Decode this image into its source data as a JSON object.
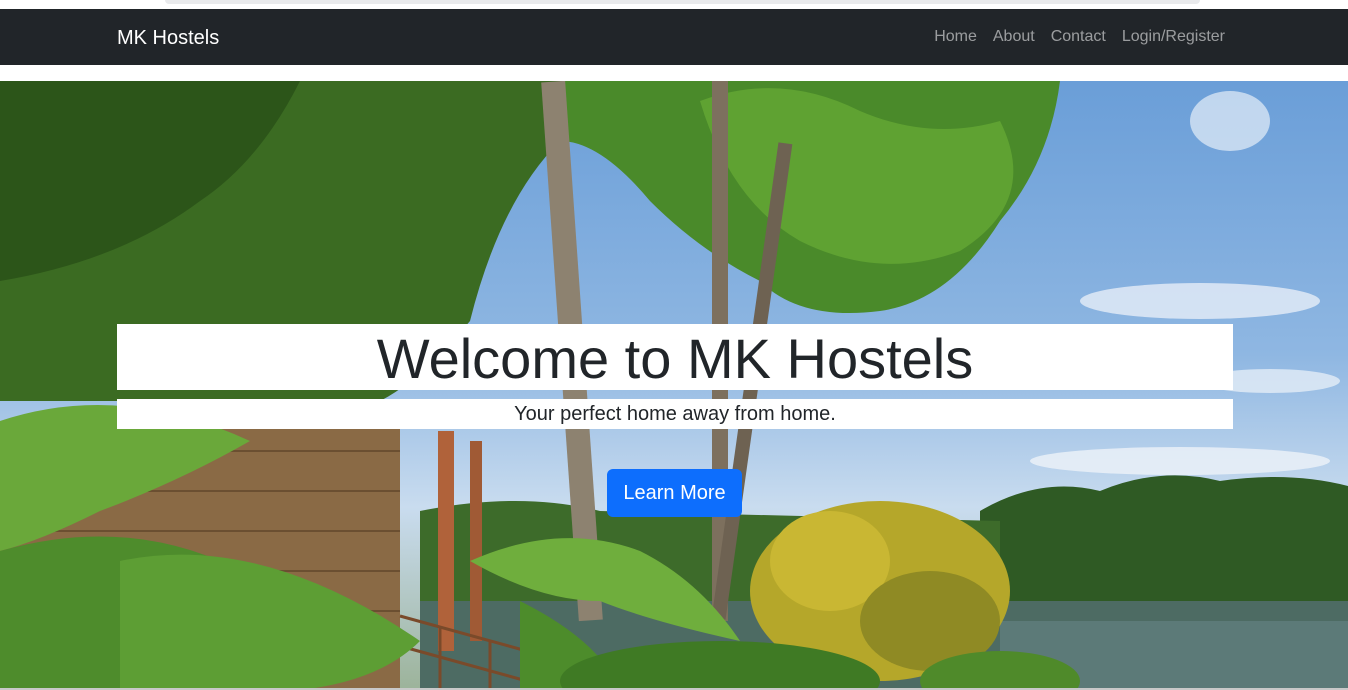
{
  "navbar": {
    "brand": "MK Hostels",
    "links": [
      {
        "label": "Home"
      },
      {
        "label": "About"
      },
      {
        "label": "Contact"
      },
      {
        "label": "Login/Register"
      }
    ],
    "background": "#212529"
  },
  "hero": {
    "title": "Welcome to MK Hostels",
    "subtitle": "Your perfect home away from home.",
    "cta_label": "Learn More",
    "cta_color": "#0d6efd",
    "image": "tropical-resort-landscape-photo"
  }
}
